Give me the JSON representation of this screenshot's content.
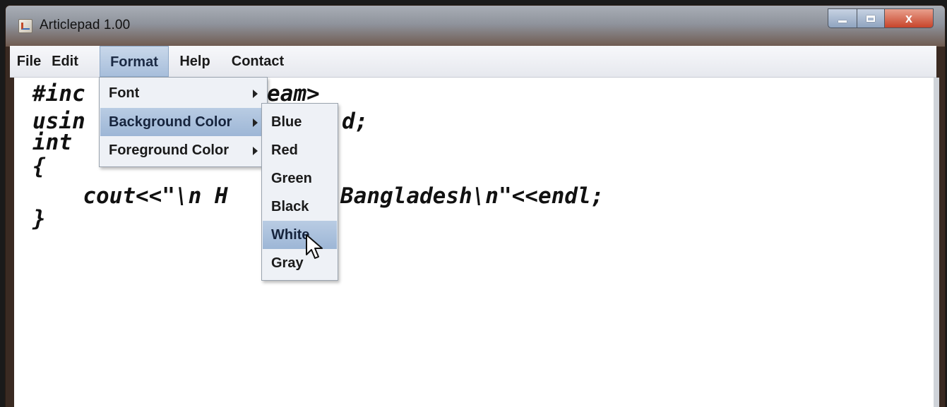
{
  "window": {
    "title": "Articlepad 1.00",
    "close_glyph": "x"
  },
  "menubar": {
    "items": [
      "File",
      "Edit",
      "Format",
      "Help",
      "Contact"
    ],
    "active": "Format"
  },
  "format_menu": {
    "items": [
      "Font",
      "Background Color",
      "Foreground Color"
    ],
    "selected": "Background Color"
  },
  "background_color_submenu": {
    "items": [
      "Blue",
      "Red",
      "Green",
      "Black",
      "White",
      "Gray"
    ],
    "hovered": "White"
  },
  "editor": {
    "visible_lines": [
      "#inc",
      "eam>",
      "usin",
      "d;",
      "int",
      "{",
      "  cout<<\"\\n H",
      "Bangladesh\\n\"<<endl;",
      "}"
    ]
  },
  "icons": {
    "app": "java-cup-icon",
    "cursor": "arrow-pointer-icon",
    "submenu_arrow": "triangle-right-icon"
  }
}
